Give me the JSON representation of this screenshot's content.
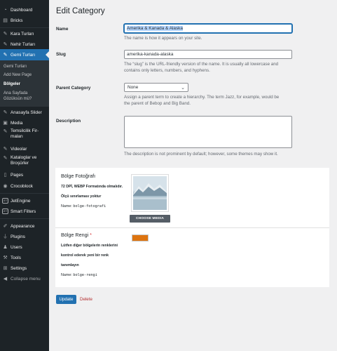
{
  "sidebar": {
    "items": [
      {
        "label": "Dashboard",
        "icon": "dashboard-icon"
      },
      {
        "label": "Bricks",
        "icon": "bricks-icon"
      },
      {
        "label": "Kara Turları",
        "icon": "pin-icon"
      },
      {
        "label": "Nehir Turları",
        "icon": "pin-icon"
      },
      {
        "label": "Gemi Turları",
        "icon": "pin-icon"
      },
      {
        "label": "Anasayfa Slider",
        "icon": "pin-icon"
      },
      {
        "label": "Media",
        "icon": "media-icon"
      },
      {
        "label": "Temsilcilik Fir-maları",
        "icon": "pin-icon"
      },
      {
        "label": "Videolar",
        "icon": "video-icon"
      },
      {
        "label": "Kataloglar ve Broşürler",
        "icon": "pin-icon"
      },
      {
        "label": "Pages",
        "icon": "pages-icon"
      },
      {
        "label": "Crocoblock",
        "icon": "crocoblock-icon"
      },
      {
        "label": "JetEngine",
        "icon": "jet-icon"
      },
      {
        "label": "Smart Filters",
        "icon": "jet-icon"
      },
      {
        "label": "Appearance",
        "icon": "brush-icon"
      },
      {
        "label": "Plugins",
        "icon": "plug-icon"
      },
      {
        "label": "Users",
        "icon": "user-icon"
      },
      {
        "label": "Tools",
        "icon": "wrench-icon"
      },
      {
        "label": "Settings",
        "icon": "settings-icon"
      },
      {
        "label": "Collapse menu",
        "icon": "collapse-icon"
      }
    ],
    "submenu": [
      "Gemi Turları",
      "Add New Page",
      "Bölgeler",
      "Ana Sayfada Gözüksün mü?"
    ],
    "jet_badge": "JET"
  },
  "page": {
    "title": "Edit Category",
    "name_label": "Name",
    "name_value": "Amerika & Kanada & Alaska",
    "name_desc": "The name is how it appears on your site.",
    "slug_label": "Slug",
    "slug_value": "amerika-kanada-alaska",
    "slug_desc_1": "The “slug” is the URL-friendly version of the name. It is usually all lowercase and",
    "slug_desc_2": "contains only letters, numbers, and hyphens.",
    "parent_label": "Parent Category",
    "parent_value": "None",
    "parent_desc_1": "Assign a parent term to create a hierarchy. The term Jazz, for example, would be",
    "parent_desc_2": "the parent of Bebop and Big Band.",
    "description_label": "Description",
    "description_value": "",
    "description_desc": "The description is not prominent by default; however, some themes may show it."
  },
  "fields": {
    "photo_title": "Bölge Fotoğrafı",
    "photo_note_1": "72 DPİ, WEBP Formatında olmalıdır.",
    "photo_note_2": "Ölçü sınırlaması yoktur",
    "photo_name_prefix": "Name:",
    "photo_name": "bolge-fotografi",
    "choose_media": "CHOOSE MEDIA",
    "color_title": "Bölge Rengi",
    "color_required": "*",
    "color_note_1": "Lütfen diğer bölgelerin renklerini",
    "color_note_2": "kontrol ederek yeni bir renk",
    "color_note_3": "tanımlayın",
    "color_name_prefix": "Name:",
    "color_name": "bolge-rengi",
    "color_value": "#dd7410"
  },
  "actions": {
    "update": "Update",
    "delete": "Delete"
  },
  "colors": {
    "sidebar_bg": "#1d2327",
    "active": "#2271b1",
    "delete": "#b32d2e"
  }
}
